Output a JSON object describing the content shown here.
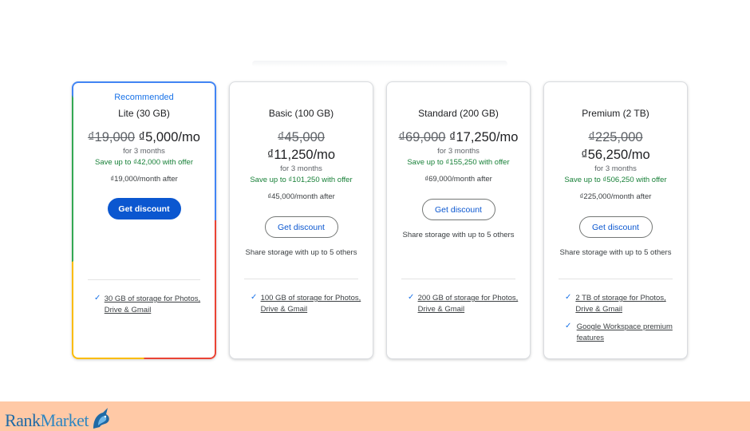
{
  "recommended_label": "Recommended",
  "plans": [
    {
      "name": "Lite (30 GB)",
      "old_price": "₫19,000",
      "new_price": "₫5,000/mo",
      "period": "for 3 months",
      "save": "Save up to ₫42,000 with offer",
      "after": "₫19,000/month after",
      "button": "Get discount",
      "share": "",
      "features": [
        "30 GB of storage for Photos, Drive & Gmail"
      ]
    },
    {
      "name": "Basic (100 GB)",
      "old_price": "₫45,000",
      "new_price": "₫11,250/mo",
      "period": "for 3 months",
      "save": "Save up to ₫101,250 with offer",
      "after": "₫45,000/month after",
      "button": "Get discount",
      "share": "Share storage with up to 5 others",
      "features": [
        "100 GB of storage for Photos, Drive & Gmail"
      ]
    },
    {
      "name": "Standard (200 GB)",
      "old_price": "₫69,000",
      "new_price": "₫17,250/mo",
      "period": "for 3 months",
      "save": "Save up to ₫155,250 with offer",
      "after": "₫69,000/month after",
      "button": "Get discount",
      "share": "Share storage with up to 5 others",
      "features": [
        "200 GB of storage for Photos, Drive & Gmail"
      ]
    },
    {
      "name": "Premium (2 TB)",
      "old_price": "₫225,000",
      "new_price": "₫56,250/mo",
      "period": "for 3 months",
      "save": "Save up to ₫506,250 with offer",
      "after": "₫225,000/month after",
      "button": "Get discount",
      "share": "Share storage with up to 5 others",
      "features": [
        "2 TB of storage for Photos, Drive & Gmail",
        "Google Workspace premium features"
      ]
    }
  ],
  "footer": {
    "logo_rank": "Rank",
    "logo_market": "Market",
    "logo_icon": "unicorn-icon"
  },
  "colors": {
    "accent_blue": "#0b57d0",
    "save_green": "#188038",
    "footer_bg": "#ffc9a6"
  }
}
